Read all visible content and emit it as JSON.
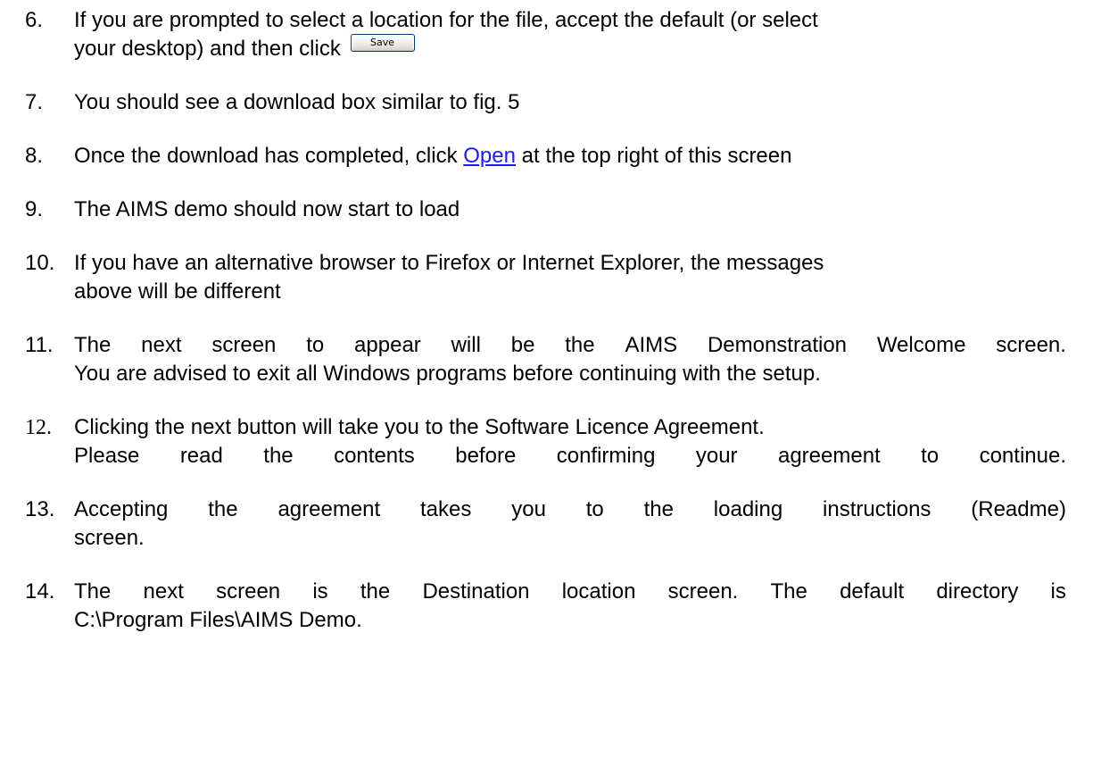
{
  "steps": [
    {
      "num": "6.",
      "line1": "If you are prompted to select a location for the file, accept the default (or select",
      "line2": "your desktop) and then click",
      "button_label": "Save"
    },
    {
      "num": "7.",
      "text": "You should see a download box similar to fig. 5"
    },
    {
      "num": "8.",
      "before": "Once the download has completed, click",
      "link": "Open",
      "after": "at the top right of this screen"
    },
    {
      "num": "9.",
      "text": "The AIMS demo should now start to load"
    },
    {
      "num": "10.",
      "line1": "If you have an alternative browser to Firefox or Internet Explorer, the messages",
      "line2": "above will be different"
    },
    {
      "num": "11.",
      "line1_words": [
        "The",
        "next",
        "screen",
        "to",
        "appear",
        "will",
        "be",
        "the",
        "AIMS",
        "Demonstration",
        "Welcome",
        "screen."
      ],
      "line2": "You are advised to exit all Windows programs before continuing with the setup."
    },
    {
      "num": "12.",
      "line1": "Clicking the next button will take you to the Software Licence Agreement.",
      "line2_words": [
        "Please",
        "read",
        "the",
        "contents",
        "before",
        "confirming",
        "your",
        "agreement",
        "to",
        "continue."
      ]
    },
    {
      "num": "13.",
      "line1_words": [
        "Accepting",
        "the",
        "agreement",
        "takes",
        "you",
        "to",
        "the",
        "loading",
        "instructions",
        "(Readme)"
      ],
      "line2": "screen."
    },
    {
      "num": "14.",
      "line1_words": [
        "The",
        "next",
        "screen",
        "is",
        "the",
        "Destination",
        "location",
        "screen.",
        "The",
        "default",
        "directory",
        "is"
      ],
      "line2": "C:\\Program Files\\AIMS Demo."
    }
  ]
}
